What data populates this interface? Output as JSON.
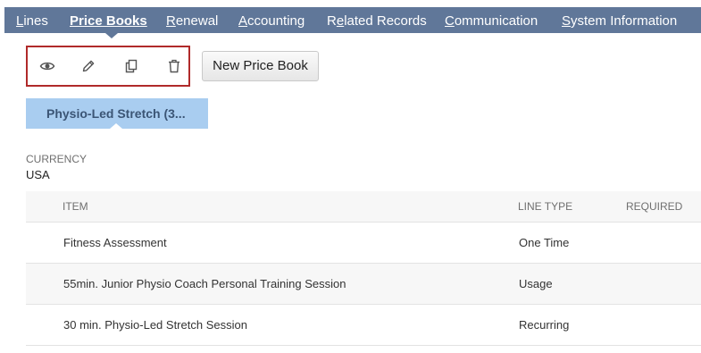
{
  "tabs": [
    {
      "underline": "L",
      "rest": "ines",
      "active": false
    },
    {
      "underline": "P",
      "rest": "rice Books",
      "active": true
    },
    {
      "underline": "R",
      "rest": "enewal",
      "active": false
    },
    {
      "underline": "A",
      "rest": "ccounting",
      "active": false
    },
    {
      "pre": "R",
      "underline": "e",
      "rest": "lated Records",
      "active": false
    },
    {
      "underline": "C",
      "rest": "ommunication",
      "active": false
    },
    {
      "underline": "S",
      "rest": "ystem Information",
      "active": false
    }
  ],
  "actions": {
    "icons": [
      "eye-icon",
      "pencil-icon",
      "copy-icon",
      "trash-icon"
    ],
    "new_label": "New Price Book"
  },
  "subtab": {
    "label": "Physio-Led Stretch (3..."
  },
  "currency": {
    "label": "CURRENCY",
    "value": "USA"
  },
  "table": {
    "headers": {
      "item": "ITEM",
      "line_type": "LINE TYPE",
      "required": "REQUIRED"
    },
    "rows": [
      {
        "item": "Fitness Assessment",
        "line_type": "One Time",
        "required": ""
      },
      {
        "item": "55min. Junior Physio Coach Personal Training Session",
        "line_type": "Usage",
        "required": ""
      },
      {
        "item": "30 min. Physio-Led Stretch Session",
        "line_type": "Recurring",
        "required": ""
      }
    ]
  },
  "colors": {
    "tab_bar": "#607799",
    "highlight_box": "#b02a2a",
    "subtab_bg": "#a9cdf0",
    "subtab_text": "#3b5575"
  }
}
